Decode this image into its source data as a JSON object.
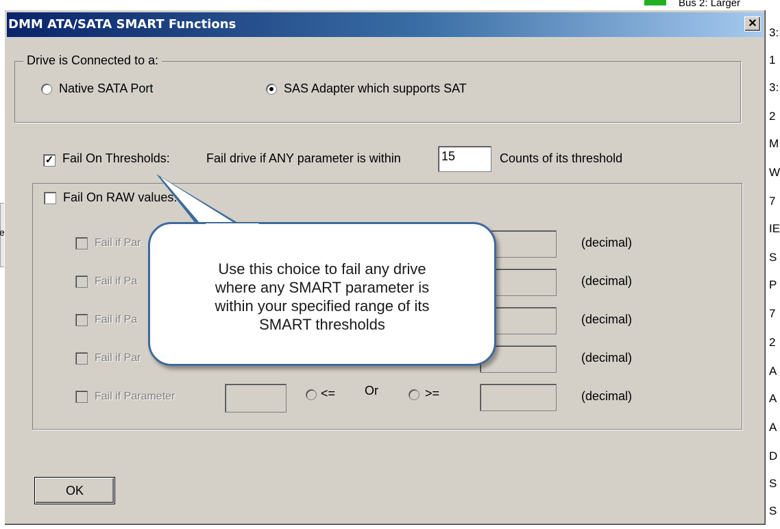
{
  "background": {
    "bus_text": "Bus 2: Larger",
    "left_tab_text": "et",
    "right_column": [
      "3:",
      "1",
      "3:",
      "2",
      "M",
      "W",
      "7",
      "IE",
      "S",
      "P",
      "7",
      "2",
      "A",
      "A",
      "A",
      "D",
      "S",
      "S"
    ]
  },
  "dialog": {
    "title": "DMM ATA/SATA SMART Functions",
    "close_label": "✕"
  },
  "connection": {
    "legend": "Drive is Connected to a:",
    "native_label": "Native SATA Port",
    "sas_label": "SAS Adapter which supports SAT",
    "selected": "sas"
  },
  "thresholds": {
    "checkbox_label": "Fail On Thresholds:",
    "checked": true,
    "description_prefix": "Fail drive if ANY parameter is within",
    "value": "15",
    "description_suffix": "Counts of its threshold"
  },
  "raw": {
    "checkbox_label": "Fail On RAW values:",
    "checked": false,
    "row_label": "Fail if Parameter",
    "row_label_partial": [
      "Fail if Par",
      "Fail if Pa",
      "Fail if Pa",
      "Fail if Par"
    ],
    "lte_label": "<=",
    "or_label": "Or",
    "gte_label": ">=",
    "unit_label": "(decimal)"
  },
  "callout": {
    "text_lines": [
      "Use this choice to fail any drive",
      "where any SMART parameter is",
      "within your specified range of its",
      "SMART thresholds"
    ]
  },
  "buttons": {
    "ok_label": "OK"
  }
}
